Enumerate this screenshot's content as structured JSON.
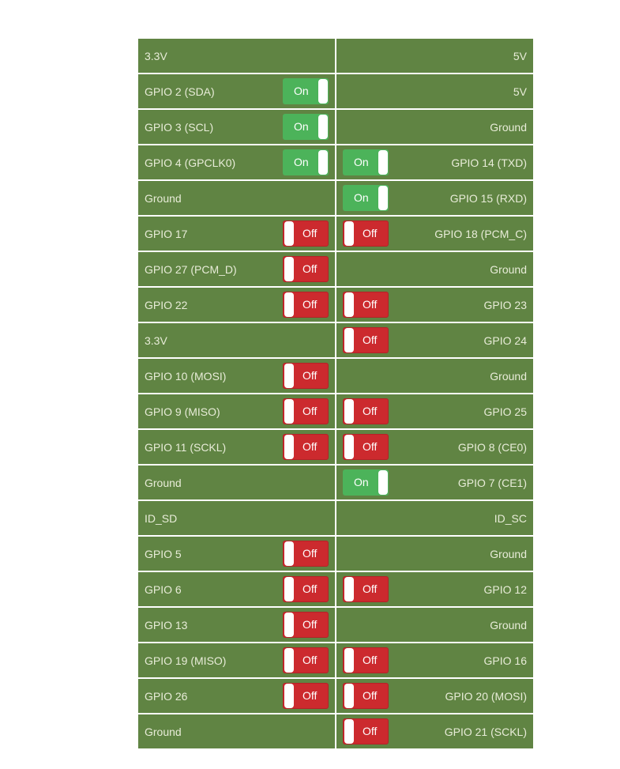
{
  "labels": {
    "on": "On",
    "off": "Off"
  },
  "colors": {
    "cell_bg": "#608443",
    "on": "#4cb35a",
    "off": "#cc2a2e",
    "text": "#e8ecd8"
  },
  "rows": [
    {
      "left": {
        "label": "3.3V",
        "state": null
      },
      "right": {
        "label": "5V",
        "state": null
      }
    },
    {
      "left": {
        "label": "GPIO 2 (SDA)",
        "state": "On"
      },
      "right": {
        "label": "5V",
        "state": null
      }
    },
    {
      "left": {
        "label": "GPIO 3 (SCL)",
        "state": "On"
      },
      "right": {
        "label": "Ground",
        "state": null
      }
    },
    {
      "left": {
        "label": "GPIO 4 (GPCLK0)",
        "state": "On"
      },
      "right": {
        "label": "GPIO 14 (TXD)",
        "state": "On"
      }
    },
    {
      "left": {
        "label": "Ground",
        "state": null
      },
      "right": {
        "label": "GPIO 15 (RXD)",
        "state": "On"
      }
    },
    {
      "left": {
        "label": "GPIO 17",
        "state": "Off"
      },
      "right": {
        "label": "GPIO 18 (PCM_C)",
        "state": "Off"
      }
    },
    {
      "left": {
        "label": "GPIO 27 (PCM_D)",
        "state": "Off"
      },
      "right": {
        "label": "Ground",
        "state": null
      }
    },
    {
      "left": {
        "label": "GPIO 22",
        "state": "Off"
      },
      "right": {
        "label": "GPIO 23",
        "state": "Off"
      }
    },
    {
      "left": {
        "label": "3.3V",
        "state": null
      },
      "right": {
        "label": "GPIO 24",
        "state": "Off"
      }
    },
    {
      "left": {
        "label": "GPIO 10 (MOSI)",
        "state": "Off"
      },
      "right": {
        "label": "Ground",
        "state": null
      }
    },
    {
      "left": {
        "label": "GPIO 9 (MISO)",
        "state": "Off"
      },
      "right": {
        "label": "GPIO 25",
        "state": "Off"
      }
    },
    {
      "left": {
        "label": "GPIO 11 (SCKL)",
        "state": "Off"
      },
      "right": {
        "label": "GPIO 8 (CE0)",
        "state": "Off"
      }
    },
    {
      "left": {
        "label": "Ground",
        "state": null
      },
      "right": {
        "label": "GPIO 7 (CE1)",
        "state": "On"
      }
    },
    {
      "left": {
        "label": "ID_SD",
        "state": null
      },
      "right": {
        "label": "ID_SC",
        "state": null
      }
    },
    {
      "left": {
        "label": "GPIO 5",
        "state": "Off"
      },
      "right": {
        "label": "Ground",
        "state": null
      }
    },
    {
      "left": {
        "label": "GPIO 6",
        "state": "Off"
      },
      "right": {
        "label": "GPIO 12",
        "state": "Off"
      }
    },
    {
      "left": {
        "label": "GPIO 13",
        "state": "Off"
      },
      "right": {
        "label": "Ground",
        "state": null
      }
    },
    {
      "left": {
        "label": "GPIO 19 (MISO)",
        "state": "Off"
      },
      "right": {
        "label": "GPIO 16",
        "state": "Off"
      }
    },
    {
      "left": {
        "label": "GPIO 26",
        "state": "Off"
      },
      "right": {
        "label": "GPIO 20 (MOSI)",
        "state": "Off"
      }
    },
    {
      "left": {
        "label": "Ground",
        "state": null
      },
      "right": {
        "label": "GPIO 21 (SCKL)",
        "state": "Off"
      }
    }
  ]
}
